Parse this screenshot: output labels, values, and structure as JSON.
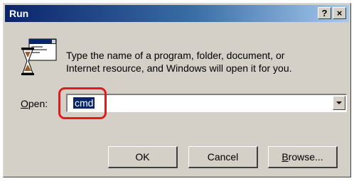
{
  "dialog": {
    "title": "Run",
    "help_label": "?",
    "close_label": "×",
    "icon": "run-icon",
    "description_line1": "Type the name of a program, folder, document, or",
    "description_line2": "Internet resource, and Windows will open it for you.",
    "open_label_accel": "O",
    "open_label_rest": "pen:",
    "open_value": "cmd",
    "ok_label": "OK",
    "cancel_label": "Cancel",
    "browse_label_accel": "B",
    "browse_label_rest": "rowse...",
    "highlight_color": "#e01b1b"
  }
}
